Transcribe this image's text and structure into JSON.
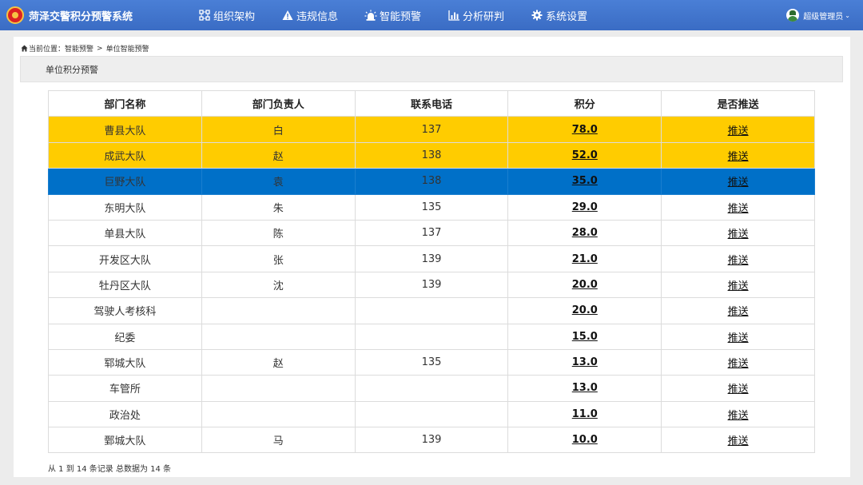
{
  "app": {
    "title": "菏泽交警积分预警系统"
  },
  "nav": [
    {
      "icon": "org-structure-icon",
      "label": "组织架构"
    },
    {
      "icon": "warning-icon",
      "label": "违规信息"
    },
    {
      "icon": "alarm-light-icon",
      "label": "智能预警"
    },
    {
      "icon": "bar-chart-icon",
      "label": "分析研判"
    },
    {
      "icon": "gear-icon",
      "label": "系统设置"
    }
  ],
  "user": {
    "label": "超级管理员"
  },
  "breadcrumb": {
    "prefix": "当前位置：",
    "items": [
      "智能预警",
      "单位智能预警"
    ],
    "separator": ">"
  },
  "section": {
    "title": "单位积分预警"
  },
  "table": {
    "columns": [
      "部门名称",
      "部门负责人",
      "联系电话",
      "积分",
      "是否推送"
    ],
    "rows": [
      {
        "dept": "曹县大队",
        "leader": "白",
        "phone": "137",
        "score": "78.0",
        "push": "推送",
        "level": "high"
      },
      {
        "dept": "成武大队",
        "leader": "赵",
        "phone": "138",
        "score": "52.0",
        "push": "推送",
        "level": "high"
      },
      {
        "dept": "巨野大队",
        "leader": "袁",
        "phone": "138",
        "score": "35.0",
        "push": "推送",
        "level": "mid"
      },
      {
        "dept": "东明大队",
        "leader": "朱",
        "phone": "135",
        "score": "29.0",
        "push": "推送",
        "level": ""
      },
      {
        "dept": "单县大队",
        "leader": "陈",
        "phone": "137",
        "score": "28.0",
        "push": "推送",
        "level": ""
      },
      {
        "dept": "开发区大队",
        "leader": "张",
        "phone": "139",
        "score": "21.0",
        "push": "推送",
        "level": ""
      },
      {
        "dept": "牡丹区大队",
        "leader": "沈",
        "phone": "139",
        "score": "20.0",
        "push": "推送",
        "level": ""
      },
      {
        "dept": "驾驶人考核科",
        "leader": "",
        "phone": "",
        "score": "20.0",
        "push": "推送",
        "level": ""
      },
      {
        "dept": "纪委",
        "leader": "",
        "phone": "",
        "score": "15.0",
        "push": "推送",
        "level": ""
      },
      {
        "dept": "郓城大队",
        "leader": "赵",
        "phone": "135",
        "score": "13.0",
        "push": "推送",
        "level": ""
      },
      {
        "dept": "车管所",
        "leader": "",
        "phone": "",
        "score": "13.0",
        "push": "推送",
        "level": ""
      },
      {
        "dept": "政治处",
        "leader": "",
        "phone": "",
        "score": "11.0",
        "push": "推送",
        "level": ""
      },
      {
        "dept": "鄄城大队",
        "leader": "马",
        "phone": "139",
        "score": "10.0",
        "push": "推送",
        "level": ""
      }
    ]
  },
  "footer": {
    "summary": "从 1 到 14 条记录 总数据为 14 条"
  },
  "colors": {
    "nav_bg": "#3f74cc",
    "high_warning": "#ffcc00",
    "mid_warning": "#0070c8"
  }
}
